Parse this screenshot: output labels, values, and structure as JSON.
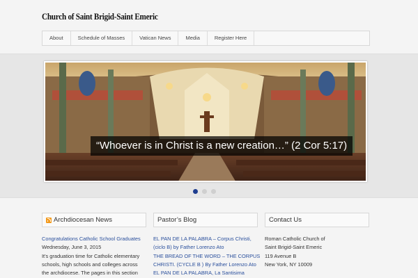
{
  "site": {
    "title": "Church of Saint Brigid-Saint Emeric"
  },
  "nav": {
    "items": [
      "About",
      "Schedule of Masses",
      "Vatican News",
      "Media",
      "Register Here"
    ]
  },
  "slider": {
    "caption": "“Whoever is in Christ is a new creation…” (2 Cor 5:17)",
    "slide_count": 3,
    "active_slide": 1
  },
  "news": {
    "title": "Archdiocesan News",
    "headline": "Congratulations Catholic School Graduates",
    "date": "Wednesday, June 3, 2015",
    "excerpt": [
      "It's graduation time for Catholic elementary",
      "schools, high schools and colleges across",
      "the archdiocese. The pages in this section"
    ]
  },
  "blog": {
    "title": "Pastor’s Blog",
    "lines": [
      "EL PAN DE LA PALABRA – Corpus Christi,",
      "(ciclo B) by Father Lorenzo Ato",
      "THE BREAD OF THE WORD – THE CORPUS",
      "CHRISTI. (CYCLE B ) By Father Lorenzo Ato",
      "EL PAN DE LA PALABRA, La Santisima"
    ]
  },
  "contact": {
    "title": "Contact Us",
    "lines": [
      "Roman Catholic Church of",
      "Saint Brigid-Saint Emeric",
      "119 Avenue B",
      "New York, NY 10009"
    ]
  }
}
